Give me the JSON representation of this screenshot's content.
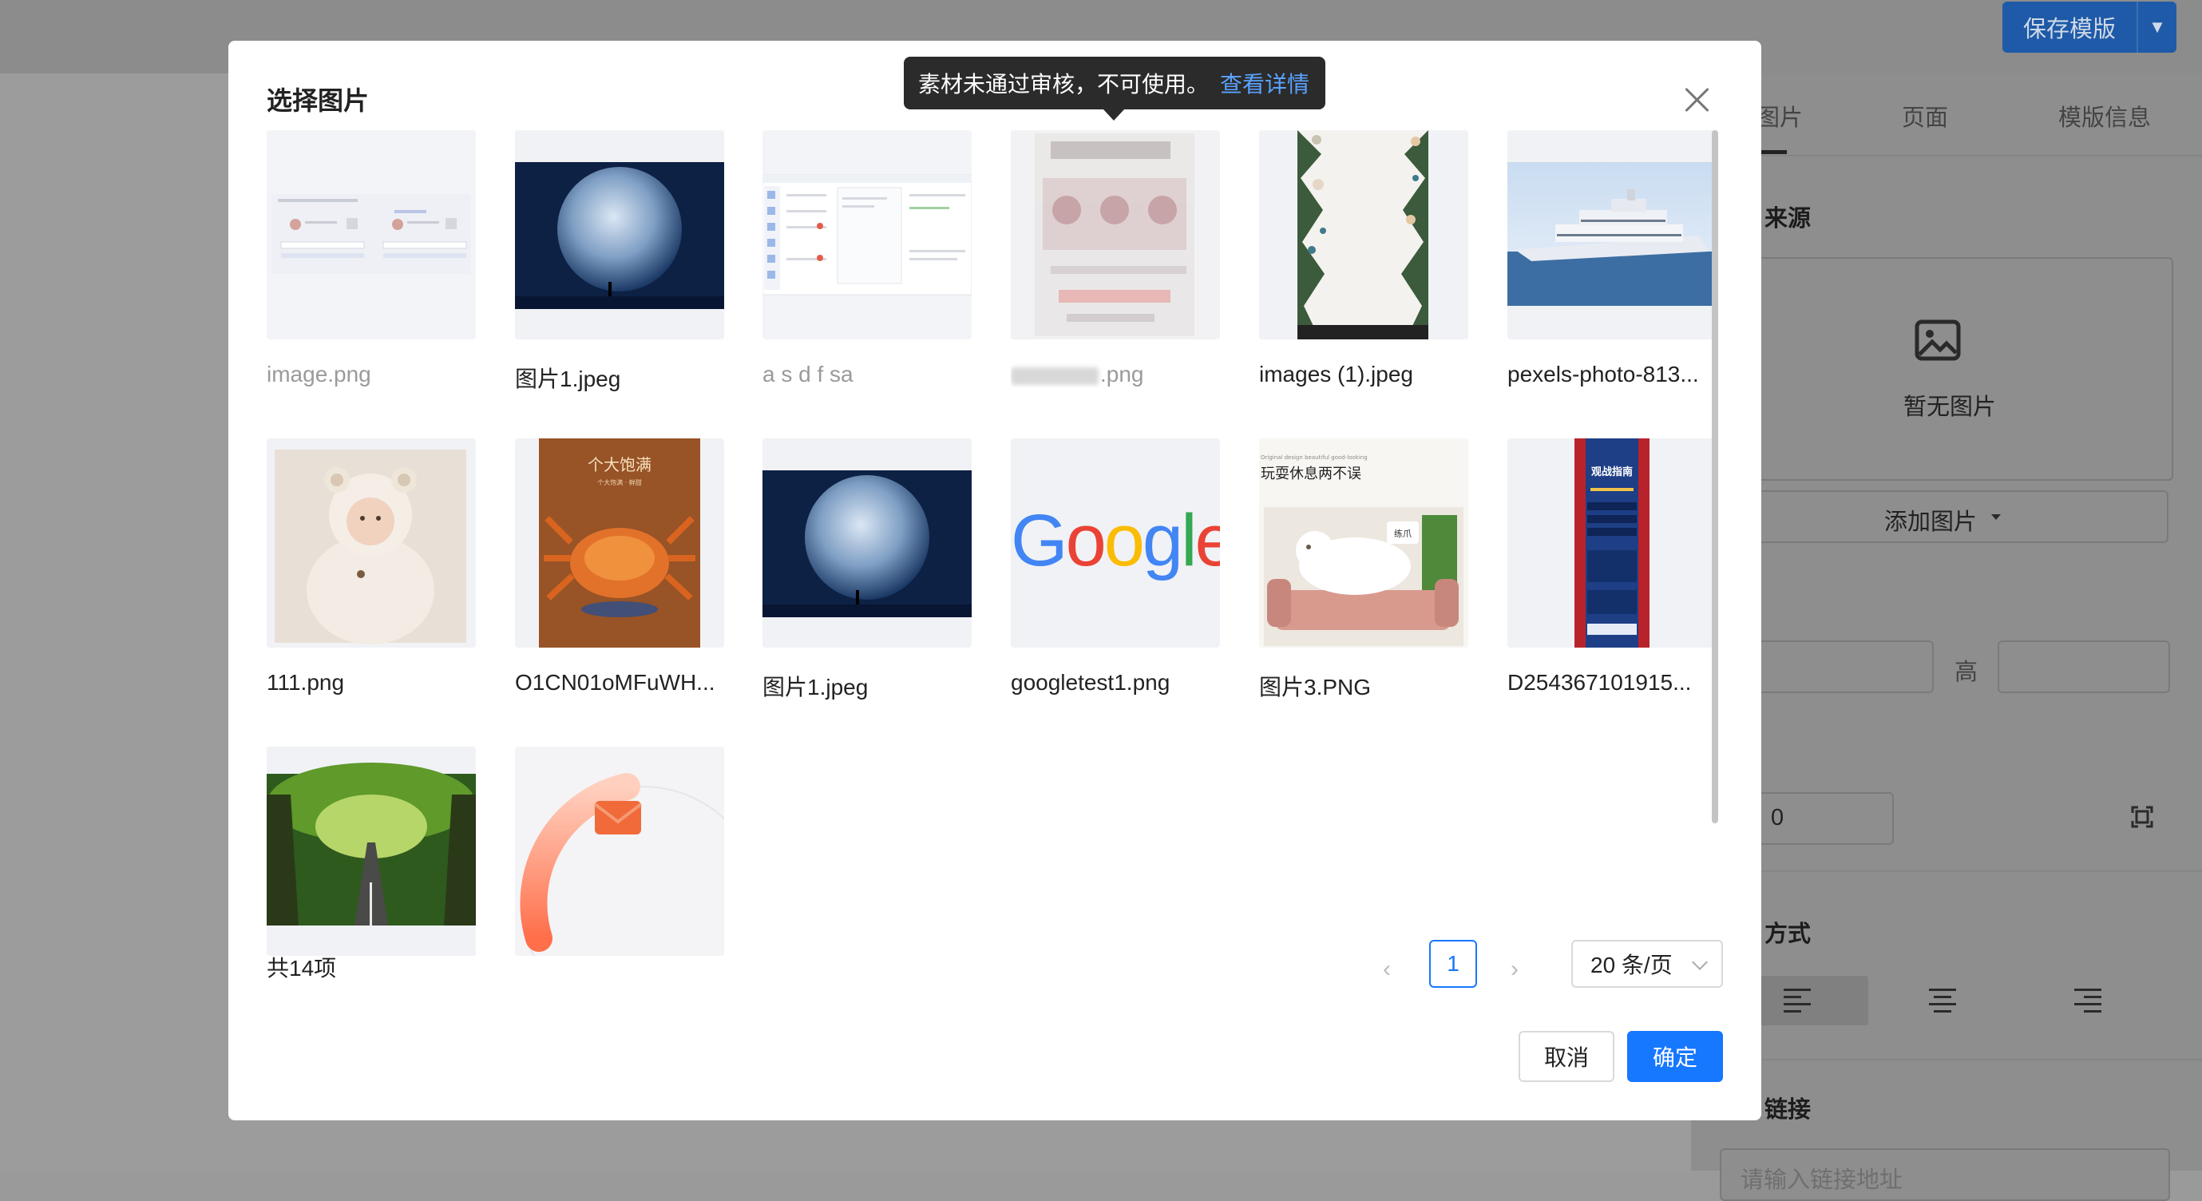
{
  "topbar": {
    "save_label": "保存模版",
    "save_dropdown": "▼"
  },
  "right_panel": {
    "tabs": [
      "图片",
      "页面",
      "模版信息"
    ],
    "source_label": "来源",
    "empty_text": "暂无图片",
    "add_image": "添加图片",
    "height_label": "高",
    "value_zero": "0",
    "align_label": "方式",
    "link_label": "链接",
    "link_placeholder": "请输入链接地址"
  },
  "dialog": {
    "title": "选择图片",
    "tooltip_text": "素材未通过审核，不可使用。",
    "tooltip_link": "查看详情",
    "items": [
      {
        "name": "image.png",
        "disabled": true
      },
      {
        "name": "图片1.jpeg",
        "disabled": false
      },
      {
        "name": "a s d f sa",
        "disabled": true
      },
      {
        "name": ".png",
        "disabled": true
      },
      {
        "name": "images (1).jpeg",
        "disabled": false
      },
      {
        "name": "pexels-photo-813...",
        "disabled": false
      },
      {
        "name": "111.png",
        "disabled": false
      },
      {
        "name": "O1CN01oMFuWH...",
        "disabled": false
      },
      {
        "name": "图片1.jpeg",
        "disabled": false
      },
      {
        "name": "googletest1.png",
        "disabled": false
      },
      {
        "name": "图片3.PNG",
        "disabled": false
      },
      {
        "name": "D254367101915...",
        "disabled": false
      },
      {
        "name": "",
        "disabled": false
      },
      {
        "name": "",
        "disabled": false
      }
    ],
    "thumb_text": {
      "crab_title": "个大饱满",
      "crab_sub": "个大饱满 · 鲜甜",
      "google": "Google",
      "cat_title": "玩耍休息两不误",
      "cat_small": "Original design beautiful good-looking",
      "cat_badge": "练爪",
      "poster_title": "观战指南"
    },
    "pagination": {
      "total": "共14项",
      "prev": "‹",
      "current": "1",
      "next": "›",
      "page_size": "20 条/页"
    },
    "cancel": "取消",
    "ok": "确定"
  }
}
